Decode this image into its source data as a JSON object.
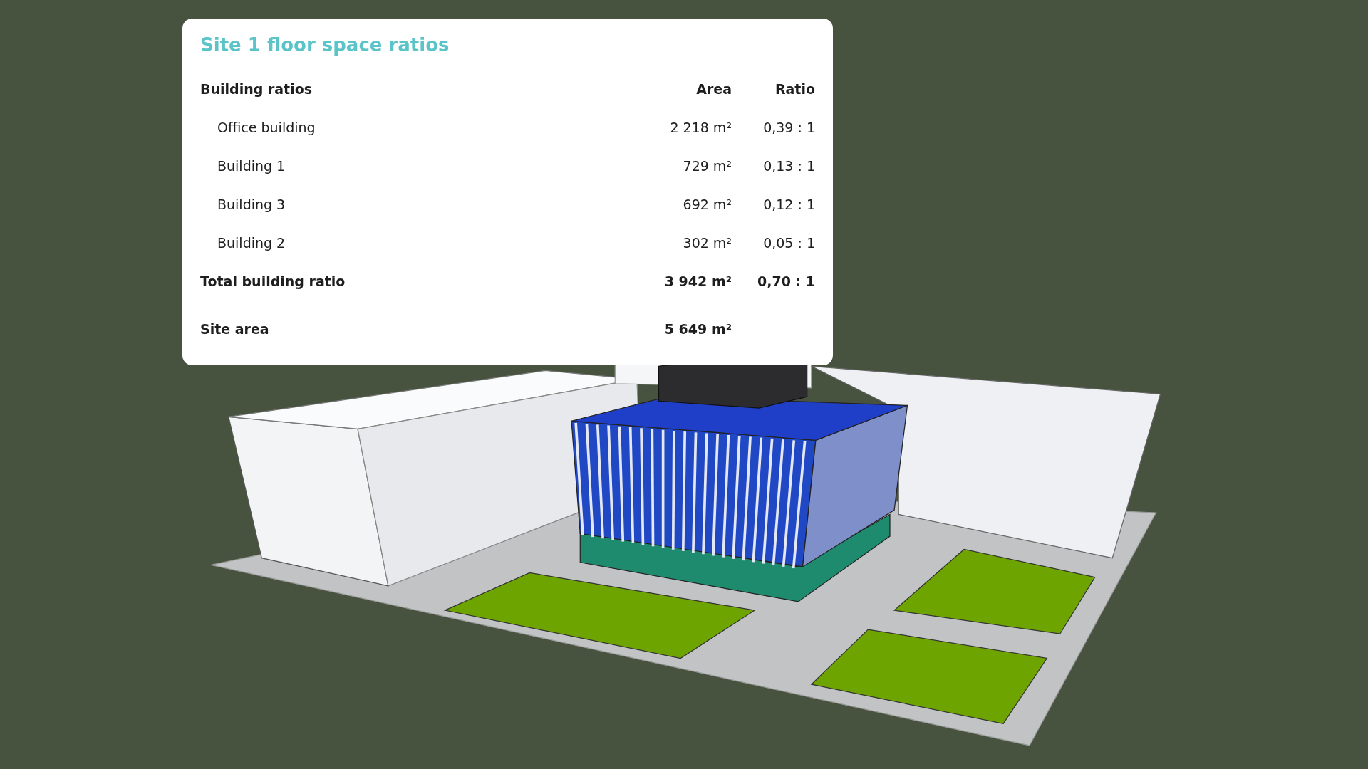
{
  "card": {
    "title": "Site 1 floor space ratios",
    "header": {
      "label": "Building ratios",
      "area": "Area",
      "ratio": "Ratio"
    },
    "rows": [
      {
        "name": "Office building",
        "area": "2 218 m²",
        "ratio": "0,39 : 1"
      },
      {
        "name": "Building 1",
        "area": "729 m²",
        "ratio": "0,13 : 1"
      },
      {
        "name": "Building 3",
        "area": "692 m²",
        "ratio": "0,12 : 1"
      },
      {
        "name": "Building 2",
        "area": "302 m²",
        "ratio": "0,05 : 1"
      }
    ],
    "total": {
      "label": "Total building ratio",
      "area": "3 942 m²",
      "ratio": "0,70 : 1"
    },
    "site": {
      "label": "Site area",
      "area": "5 649 m²"
    }
  }
}
